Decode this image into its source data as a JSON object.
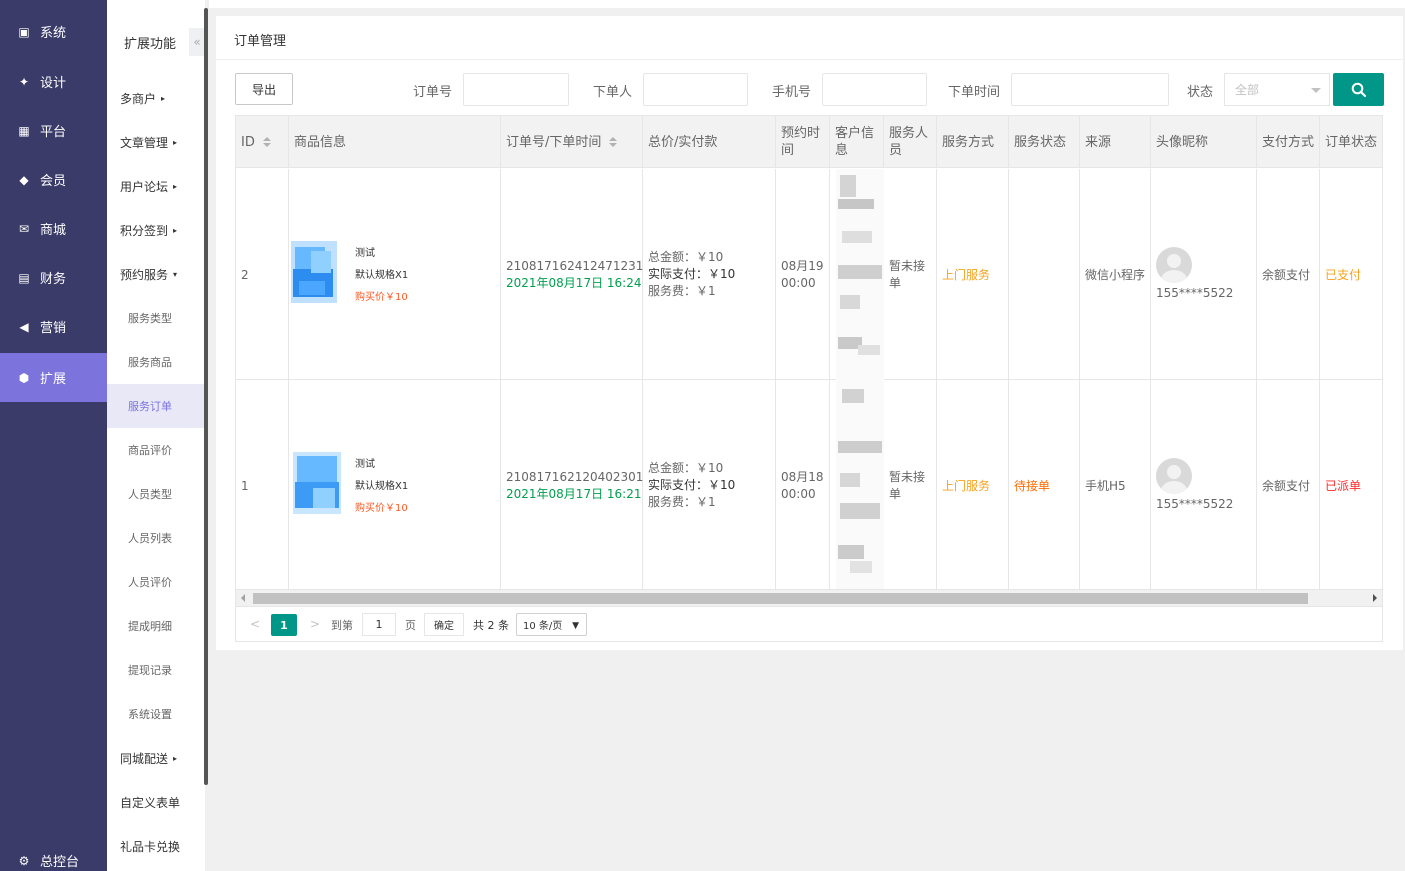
{
  "nav_main": [
    {
      "label": "系统",
      "icon": "monitor-icon",
      "glyph": "▣",
      "active": false
    },
    {
      "label": "设计",
      "icon": "pin-icon",
      "glyph": "✦",
      "active": false
    },
    {
      "label": "平台",
      "icon": "grid-icon",
      "glyph": "▦",
      "active": false
    },
    {
      "label": "会员",
      "icon": "diamond-icon",
      "glyph": "◆",
      "active": false
    },
    {
      "label": "商城",
      "icon": "mail-icon",
      "glyph": "✉",
      "active": false
    },
    {
      "label": "财务",
      "icon": "wallet-icon",
      "glyph": "▤",
      "active": false
    },
    {
      "label": "营销",
      "icon": "megaphone-icon",
      "glyph": "◀",
      "active": false
    },
    {
      "label": "扩展",
      "icon": "cube-icon",
      "glyph": "⬢",
      "active": true
    }
  ],
  "nav_bottom": {
    "label": "总控台",
    "icon": "gear-icon",
    "glyph": "⚙"
  },
  "sub_nav": {
    "title": "扩展功能",
    "collapse_glyph": "«",
    "items": [
      {
        "label": "多商户",
        "type": "top",
        "arrow": "▸",
        "active": false
      },
      {
        "label": "文章管理",
        "type": "top",
        "arrow": "▸",
        "active": false
      },
      {
        "label": "用户论坛",
        "type": "top",
        "arrow": "▸",
        "active": false
      },
      {
        "label": "积分签到",
        "type": "top",
        "arrow": "▸",
        "active": false
      },
      {
        "label": "预约服务",
        "type": "top",
        "arrow": "▾",
        "active": false
      },
      {
        "label": "服务类型",
        "type": "sub",
        "arrow": "",
        "active": false
      },
      {
        "label": "服务商品",
        "type": "sub",
        "arrow": "",
        "active": false
      },
      {
        "label": "服务订单",
        "type": "sub",
        "arrow": "",
        "active": true
      },
      {
        "label": "商品评价",
        "type": "sub",
        "arrow": "",
        "active": false
      },
      {
        "label": "人员类型",
        "type": "sub",
        "arrow": "",
        "active": false
      },
      {
        "label": "人员列表",
        "type": "sub",
        "arrow": "",
        "active": false
      },
      {
        "label": "人员评价",
        "type": "sub",
        "arrow": "",
        "active": false
      },
      {
        "label": "提成明细",
        "type": "sub",
        "arrow": "",
        "active": false
      },
      {
        "label": "提现记录",
        "type": "sub",
        "arrow": "",
        "active": false
      },
      {
        "label": "系统设置",
        "type": "sub",
        "arrow": "",
        "active": false
      },
      {
        "label": "同城配送",
        "type": "top",
        "arrow": "▸",
        "active": false
      },
      {
        "label": "自定义表单",
        "type": "top",
        "arrow": "",
        "active": false
      },
      {
        "label": "礼品卡兑换",
        "type": "top",
        "arrow": "",
        "active": false
      }
    ]
  },
  "page": {
    "title": "订单管理"
  },
  "filters": {
    "export_label": "导出",
    "order_no_label": "订单号",
    "order_no_value": "",
    "buyer_label": "下单人",
    "buyer_value": "",
    "phone_label": "手机号",
    "phone_value": "",
    "time_label": "下单时间",
    "time_value": "",
    "status_label": "状态",
    "status_value": "全部",
    "search_icon": "search-icon"
  },
  "table": {
    "columns": [
      "ID",
      "商品信息",
      "订单号/下单时间",
      "总价/实付款",
      "预约时间",
      "客户信息",
      "服务人员",
      "服务方式",
      "服务状态",
      "来源",
      "头像昵称",
      "支付方式",
      "订单状态"
    ],
    "rows": [
      {
        "id": "2",
        "goods_name": "测试",
        "goods_spec": "默认规格X1",
        "goods_price": "购买价￥10",
        "order_no": "210817162412471231",
        "order_time": "2021年08月17日 16:24",
        "total": "总金额：￥10",
        "paid": "实际支付：￥10",
        "fee": "服务费：￥1",
        "appt_date": "08月19",
        "appt_time": "00:00",
        "staff": "暂未接单",
        "service_mode": "上门服务",
        "service_status": "",
        "source": "微信小程序",
        "nickname": "155****5522",
        "pay_method": "余额支付",
        "order_status": "已支付",
        "order_status_color": "#f5a31d"
      },
      {
        "id": "1",
        "goods_name": "测试",
        "goods_spec": "默认规格X1",
        "goods_price": "购买价￥10",
        "order_no": "210817162120402301",
        "order_time": "2021年08月17日 16:21",
        "total": "总金额：￥10",
        "paid": "实际支付：￥10",
        "fee": "服务费：￥1",
        "appt_date": "08月18",
        "appt_time": "00:00",
        "staff": "暂未接单",
        "service_mode": "上门服务",
        "service_status": "待接单",
        "source": "手机H5",
        "nickname": "155****5522",
        "pay_method": "余额支付",
        "order_status": "已派单",
        "order_status_color": "#ff2a2a"
      }
    ]
  },
  "pagination": {
    "prev": "<",
    "current": "1",
    "next": ">",
    "goto_label": "到第",
    "goto_value": "1",
    "page_label": "页",
    "confirm_label": "确定",
    "total_label": "共 2 条",
    "page_size": "10 条/页"
  },
  "colors": {
    "nav_bg": "#3a3b69",
    "nav_active": "#7c73dd",
    "primary": "#009688"
  }
}
